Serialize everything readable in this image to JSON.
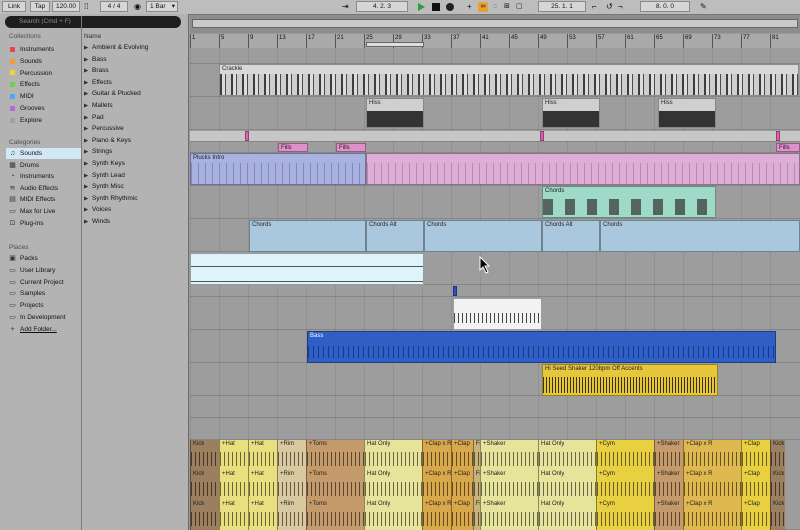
{
  "transport": {
    "link": "Link",
    "tap": "Tap",
    "tempo": "120.00",
    "signature": "4 / 4",
    "quantize": "1 Bar",
    "position": "4.  2.  3",
    "loop_start": "25.  1.  1",
    "loop_length": "8.  0.  0"
  },
  "browser": {
    "search_placeholder": "Search (Cmd + F)",
    "collections_header": "Collections",
    "collections": [
      {
        "label": "Instruments",
        "color": "#e8474a"
      },
      {
        "label": "Sounds",
        "color": "#f0a030"
      },
      {
        "label": "Percussion",
        "color": "#f2d23a"
      },
      {
        "label": "Effects",
        "color": "#6bd34a"
      },
      {
        "label": "MIDI",
        "color": "#4fa8e8"
      },
      {
        "label": "Grooves",
        "color": "#b56ad8"
      },
      {
        "label": "Explore",
        "color": "#a0a0a0"
      }
    ],
    "categories_header": "Categories",
    "categories": [
      {
        "label": "Sounds",
        "icon": "music-note-icon",
        "glyph": "♫",
        "selected": true
      },
      {
        "label": "Drums",
        "icon": "drums-icon",
        "glyph": "▦",
        "selected": false
      },
      {
        "label": "Instruments",
        "icon": "instrument-icon",
        "glyph": "◔",
        "selected": false
      },
      {
        "label": "Audio Effects",
        "icon": "audio-effects-icon",
        "glyph": "≋",
        "selected": false
      },
      {
        "label": "MIDI Effects",
        "icon": "midi-effects-icon",
        "glyph": "▤",
        "selected": false
      },
      {
        "label": "Max for Live",
        "icon": "max-for-live-icon",
        "glyph": "▭",
        "selected": false
      },
      {
        "label": "Plug-ins",
        "icon": "plugin-icon",
        "glyph": "⊡",
        "selected": false
      }
    ],
    "places_header": "Places",
    "places": [
      {
        "label": "Packs",
        "icon": "packs-icon",
        "glyph": "▣"
      },
      {
        "label": "User Library",
        "icon": "folder-icon",
        "glyph": "▭"
      },
      {
        "label": "Current Project",
        "icon": "folder-icon",
        "glyph": "▭"
      },
      {
        "label": "Samples",
        "icon": "folder-icon",
        "glyph": "▭"
      },
      {
        "label": "Projects",
        "icon": "folder-icon",
        "glyph": "▭"
      },
      {
        "label": "In Development",
        "icon": "folder-icon",
        "glyph": "▭"
      },
      {
        "label": "Add Folder...",
        "icon": "add-folder-icon",
        "glyph": "+"
      }
    ],
    "name_header": "Name",
    "names": [
      "Ambient & Evolving",
      "Bass",
      "Brass",
      "Effects",
      "Guitar & Plucked",
      "Mallets",
      "Pad",
      "Percussive",
      "Piano & Keys",
      "Strings",
      "Synth Keys",
      "Synth Lead",
      "Synth Misc",
      "Synth Rhythmic",
      "Voices",
      "Winds"
    ]
  },
  "ruler": {
    "labels": [
      "1",
      "5",
      "9",
      "13",
      "17",
      "21",
      "25",
      "29",
      "33",
      "37",
      "41",
      "45",
      "49",
      "53",
      "57",
      "61",
      "65",
      "69",
      "73",
      "77",
      "81"
    ]
  },
  "clips": {
    "crackle": "Crackle",
    "hiss": "Hiss",
    "fills": "Fills",
    "plucks_intro": "Plucks Intro",
    "chords": "Chords",
    "chords_alt": "Chords Alt",
    "bass": "Bass",
    "shaker": "Hi Seed Shaker 120bpm Off Accents"
  },
  "drum_sections": [
    {
      "label": "Kick",
      "color": "#9b7f5f",
      "start": 1,
      "end": 5
    },
    {
      "label": "+Hat",
      "color": "#e9df7e",
      "start": 5,
      "end": 9
    },
    {
      "label": "+Hat",
      "color": "#e9df7e",
      "start": 9,
      "end": 13
    },
    {
      "label": "+Rim",
      "color": "#d8c9a0",
      "start": 13,
      "end": 17
    },
    {
      "label": "+Toms",
      "color": "#c49a6a",
      "start": 17,
      "end": 25
    },
    {
      "label": "Hat Only",
      "color": "#e6e39a",
      "start": 25,
      "end": 33
    },
    {
      "label": "+Clap x R",
      "color": "#d8a84a",
      "start": 33,
      "end": 37
    },
    {
      "label": "+Clap",
      "color": "#d8a84a",
      "start": 37,
      "end": 40
    },
    {
      "label": "Fi",
      "color": "#c8b37a",
      "start": 40,
      "end": 41
    },
    {
      "label": "+Shaker",
      "color": "#e6e39a",
      "start": 41,
      "end": 49
    },
    {
      "label": "Hat Only",
      "color": "#e6e39a",
      "start": 49,
      "end": 57
    },
    {
      "label": "+Cym",
      "color": "#e8d040",
      "start": 57,
      "end": 65
    },
    {
      "label": "+Shaker",
      "color": "#c49a6a",
      "start": 65,
      "end": 69
    },
    {
      "label": "+Clap x R",
      "color": "#e0b850",
      "start": 69,
      "end": 77
    },
    {
      "label": "+Clap",
      "color": "#e8d040",
      "start": 77,
      "end": 81
    },
    {
      "label": "Kick",
      "color": "#9b7f5f",
      "start": 81,
      "end": 83
    }
  ]
}
